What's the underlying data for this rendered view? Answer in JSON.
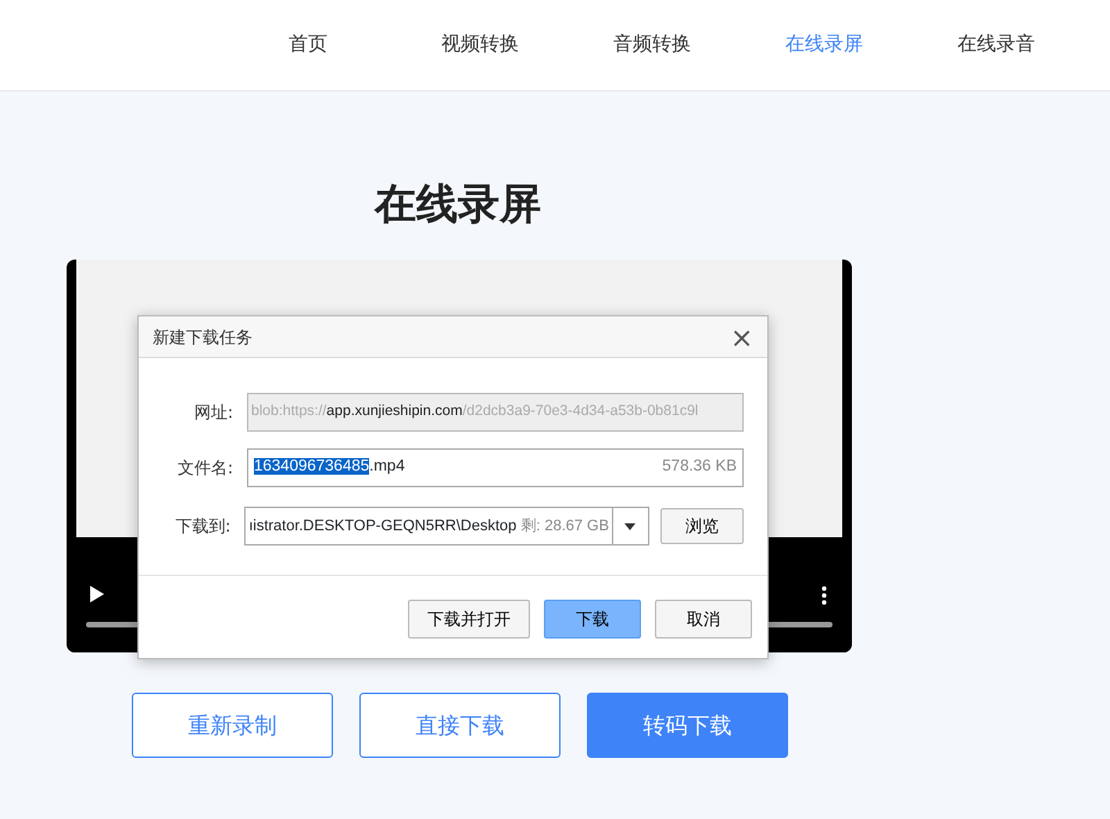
{
  "nav": [
    {
      "label": "首页",
      "selected": false
    },
    {
      "label": "视频转换",
      "selected": false
    },
    {
      "label": "音频转换",
      "selected": false
    },
    {
      "label": "在线录屏",
      "selected": true
    },
    {
      "label": "在线录音",
      "selected": false
    }
  ],
  "title": "在线录屏",
  "dialog": {
    "title": "新建下载任务",
    "close": "×",
    "url": {
      "label": "网址:",
      "prefix": "blob:https://",
      "host": "app.xunjieshipin.com",
      "rest": "/d2dcb3a9-70e3-4d34-a53b-0b81c9l"
    },
    "filename": {
      "label": "文件名:",
      "selected_part": "1634096736485",
      "rest": ".mp4",
      "size": "578.36 KB"
    },
    "save_to": {
      "label": "下载到:",
      "path": "ıistrator.DESKTOP-GEQN5RR\\Desktop",
      "free": "剩: 28.67 GB",
      "browse": "浏览"
    },
    "buttons": [
      {
        "label": "下载并打开",
        "default": false
      },
      {
        "label": "下载",
        "default": true
      },
      {
        "label": "取消",
        "default": false
      }
    ]
  },
  "actions": [
    {
      "label": "重新录制",
      "kind": "outline"
    },
    {
      "label": "直接下载",
      "kind": "outline"
    },
    {
      "label": "转码下载",
      "kind": "primary"
    }
  ]
}
